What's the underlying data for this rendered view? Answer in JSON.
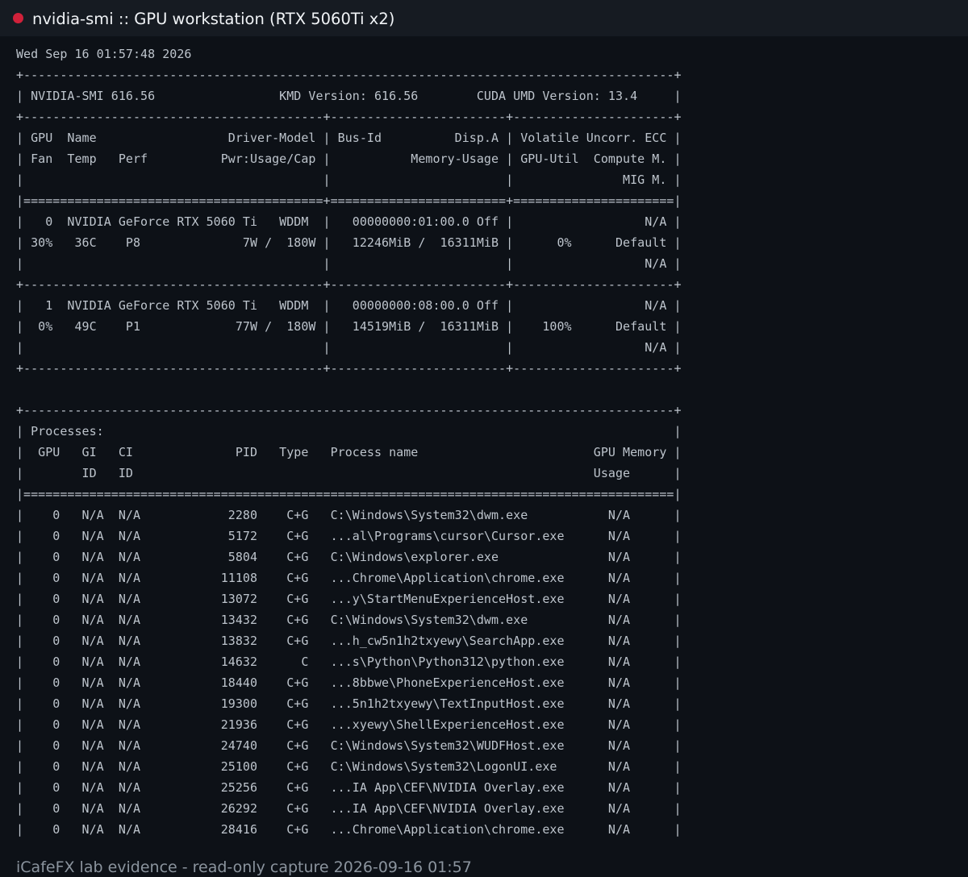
{
  "window": {
    "title": "nvidia-smi :: GPU workstation (RTX 5060Ti x2)"
  },
  "terminal": {
    "lines": [
      "Wed Sep 16 01:57:48 2026",
      "+-----------------------------------------------------------------------------------------+",
      "| NVIDIA-SMI 616.56                 KMD Version: 616.56        CUDA UMD Version: 13.4     |",
      "+-----------------------------------------+------------------------+----------------------+",
      "| GPU  Name                  Driver-Model | Bus-Id          Disp.A | Volatile Uncorr. ECC |",
      "| Fan  Temp   Perf          Pwr:Usage/Cap |           Memory-Usage | GPU-Util  Compute M. |",
      "|                                         |                        |               MIG M. |",
      "|=========================================+========================+======================|",
      "|   0  NVIDIA GeForce RTX 5060 Ti   WDDM  |   00000000:01:00.0 Off |                  N/A |",
      "| 30%   36C    P8              7W /  180W |   12246MiB /  16311MiB |      0%      Default |",
      "|                                         |                        |                  N/A |",
      "+-----------------------------------------+------------------------+----------------------+",
      "|   1  NVIDIA GeForce RTX 5060 Ti   WDDM  |   00000000:08:00.0 Off |                  N/A |",
      "|  0%   49C    P1             77W /  180W |   14519MiB /  16311MiB |    100%      Default |",
      "|                                         |                        |                  N/A |",
      "+-----------------------------------------+------------------------+----------------------+",
      "",
      "+-----------------------------------------------------------------------------------------+",
      "| Processes:                                                                              |",
      "|  GPU   GI   CI              PID   Type   Process name                        GPU Memory |",
      "|        ID   ID                                                               Usage      |",
      "|=========================================================================================|",
      "|    0   N/A  N/A            2280    C+G   C:\\Windows\\System32\\dwm.exe           N/A      |",
      "|    0   N/A  N/A            5172    C+G   ...al\\Programs\\cursor\\Cursor.exe      N/A      |",
      "|    0   N/A  N/A            5804    C+G   C:\\Windows\\explorer.exe               N/A      |",
      "|    0   N/A  N/A           11108    C+G   ...Chrome\\Application\\chrome.exe      N/A      |",
      "|    0   N/A  N/A           13072    C+G   ...y\\StartMenuExperienceHost.exe      N/A      |",
      "|    0   N/A  N/A           13432    C+G   C:\\Windows\\System32\\dwm.exe           N/A      |",
      "|    0   N/A  N/A           13832    C+G   ...h_cw5n1h2txyewy\\SearchApp.exe      N/A      |",
      "|    0   N/A  N/A           14632      C   ...s\\Python\\Python312\\python.exe      N/A      |",
      "|    0   N/A  N/A           18440    C+G   ...8bbwe\\PhoneExperienceHost.exe      N/A      |",
      "|    0   N/A  N/A           19300    C+G   ...5n1h2txyewy\\TextInputHost.exe      N/A      |",
      "|    0   N/A  N/A           21936    C+G   ...xyewy\\ShellExperienceHost.exe      N/A      |",
      "|    0   N/A  N/A           24740    C+G   C:\\Windows\\System32\\WUDFHost.exe      N/A      |",
      "|    0   N/A  N/A           25100    C+G   C:\\Windows\\System32\\LogonUI.exe       N/A      |",
      "|    0   N/A  N/A           25256    C+G   ...IA App\\CEF\\NVIDIA Overlay.exe      N/A      |",
      "|    0   N/A  N/A           26292    C+G   ...IA App\\CEF\\NVIDIA Overlay.exe      N/A      |",
      "|    0   N/A  N/A           28416    C+G   ...Chrome\\Application\\chrome.exe      N/A      |"
    ]
  },
  "footer": {
    "text": "iCafeFX lab evidence - read-only capture 2026-09-16 01:57"
  },
  "colors": {
    "background": "#0d1117",
    "titlebar": "#161b22",
    "title_dot": "#d0213a",
    "terminal_text": "#bdc4cc",
    "footer_text": "#8b949e"
  }
}
